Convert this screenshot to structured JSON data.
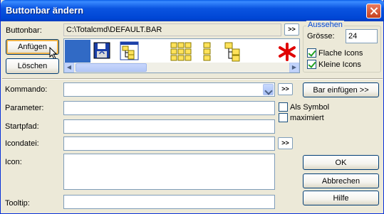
{
  "window": {
    "title": "Buttonbar ändern"
  },
  "buttonbar": {
    "label": "Buttonbar:",
    "label_mnemonic": "B",
    "path": "C:\\Totalcmd\\DEFAULT.BAR",
    "browse_label": ">>"
  },
  "actions": {
    "append_label": "Anfügen",
    "delete_label": "Löschen"
  },
  "appearance": {
    "group_label": "Aussehen",
    "size_label": "Grösse:",
    "size_value": "24",
    "flat_icons_label": "Flache Icons",
    "small_icons_label": "Kleine Icons",
    "flat_icons_checked": true,
    "small_icons_checked": true
  },
  "form": {
    "command_label": "Kommando:",
    "parameter_label": "Parameter:",
    "startpath_label": "Startpfad:",
    "iconfile_label": "Icondatei:",
    "icon_label": "Icon:",
    "tooltip_label": "Tooltip:",
    "browse_label": ">>",
    "as_symbol_label": "Als Symbol",
    "maximized_label": "maximiert",
    "insert_bar_label": "Bar einfügen >>"
  },
  "footer": {
    "ok_label": "OK",
    "cancel_label": "Abbrechen",
    "help_label": "Hilfe"
  },
  "colors": {
    "titlebar": "#0a54e0",
    "accent": "#316ac5",
    "flower": "#e00000"
  }
}
